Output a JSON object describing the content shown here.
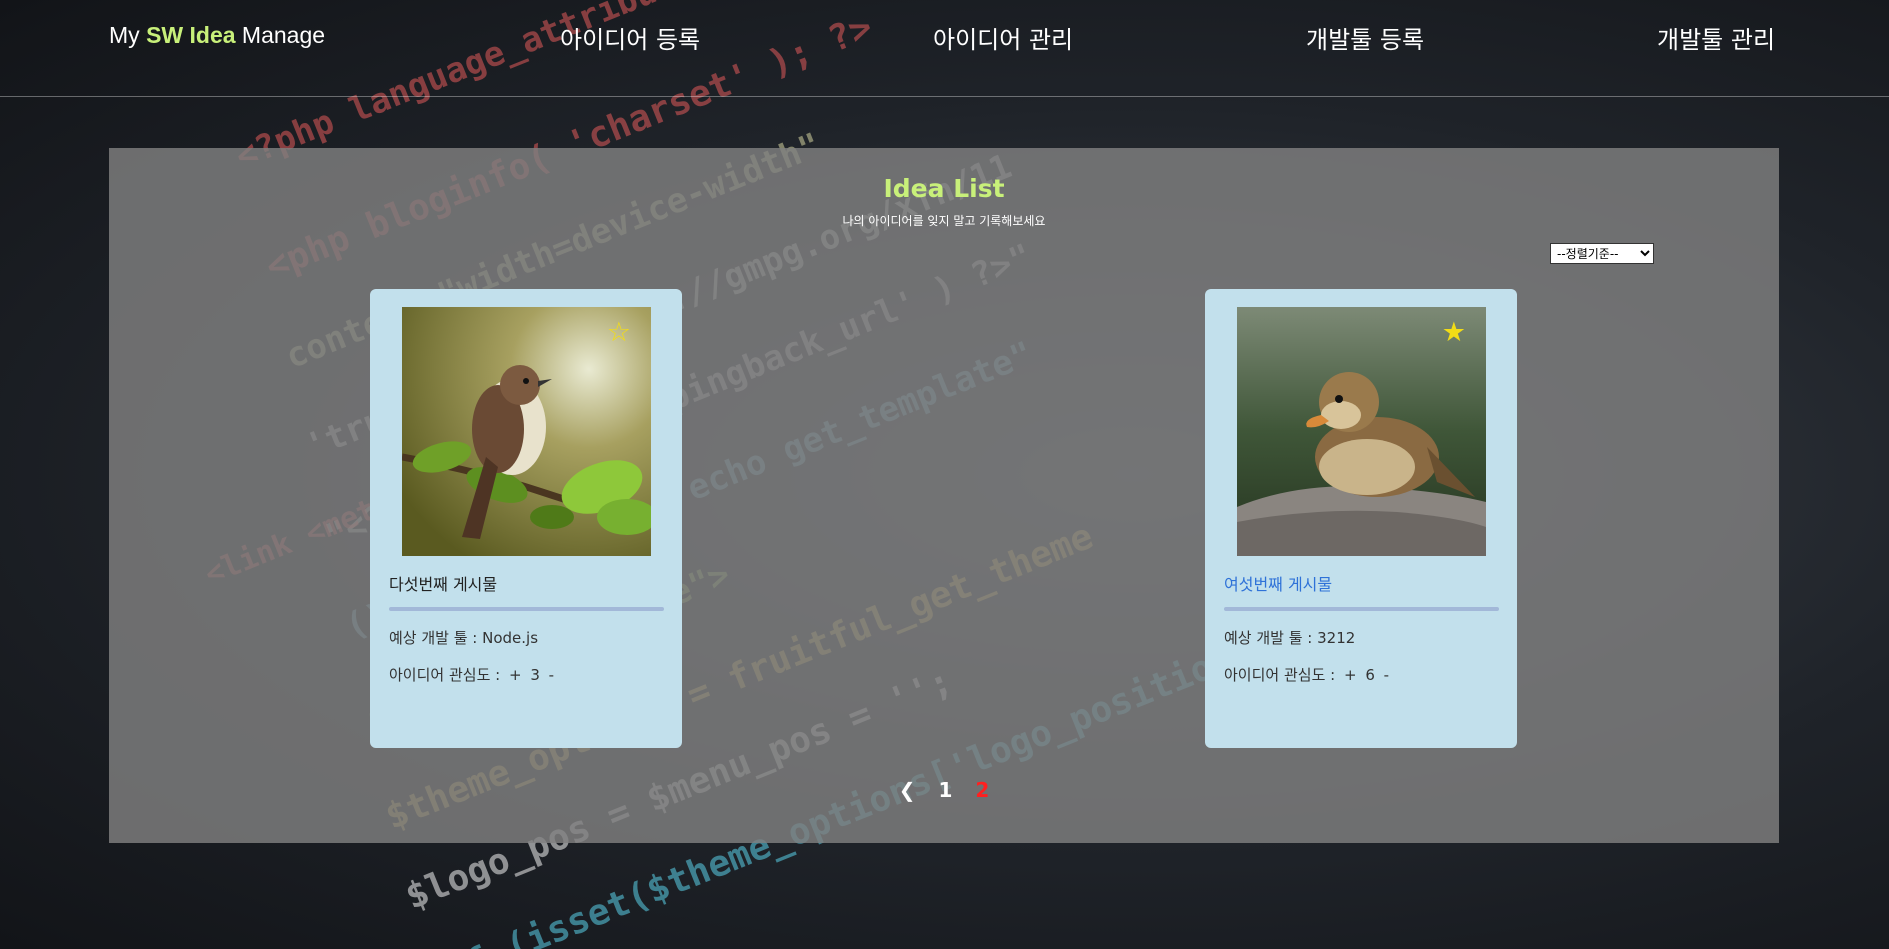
{
  "header": {
    "logo": {
      "prefix": "My ",
      "accent": "SW Idea",
      "suffix": " Manage"
    },
    "nav": [
      {
        "label": "아이디어 등록"
      },
      {
        "label": "아이디어 관리"
      },
      {
        "label": "개발툴 등록"
      },
      {
        "label": "개발툴 관리"
      }
    ]
  },
  "panel": {
    "title": "Idea List",
    "subtitle": "나의 아이디어를 잊지 말고 기록해보세요",
    "sort": {
      "selected": "--정렬기준--"
    }
  },
  "cards": [
    {
      "title": "다섯번째 게시물",
      "tool": "예상 개발 툴 : Node.js",
      "interest_label": "아이디어 관심도 :",
      "plus": "+",
      "count": "3",
      "minus": "-",
      "star": "☆",
      "image": "bird-on-branch-image"
    },
    {
      "title": "여섯번째 게시물",
      "tool": "예상 개발 툴 : 3212",
      "interest_label": "아이디어 관심도 :",
      "plus": "+",
      "count": "6",
      "minus": "-",
      "star": "★",
      "image": "duckling-on-rock-image"
    }
  ],
  "pagination": {
    "prev": "❮",
    "pages": [
      "1",
      "2"
    ],
    "current": "2"
  },
  "colors": {
    "accent": "#c8f07a",
    "card": "#c2e0ec",
    "star": "#f2dc16",
    "current_page": "#ff2020",
    "link": "#2f72d8"
  }
}
